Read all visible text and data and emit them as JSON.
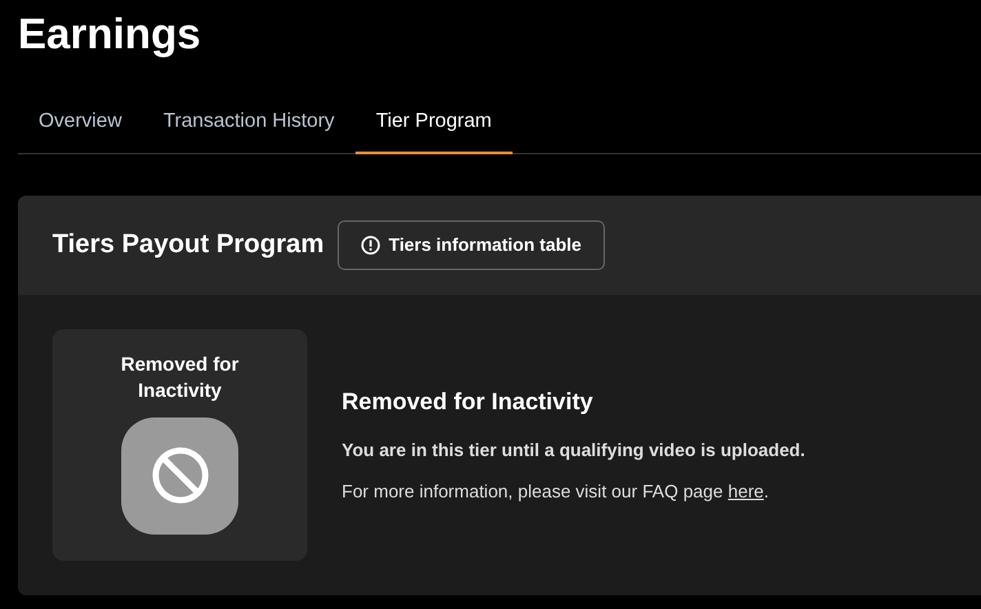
{
  "page_title": "Earnings",
  "tabs": [
    {
      "label": "Overview",
      "selected": false
    },
    {
      "label": "Transaction History",
      "selected": false
    },
    {
      "label": "Tier Program",
      "selected": true
    }
  ],
  "panel": {
    "title": "Tiers Payout Program",
    "info_button": "Tiers information table",
    "tier_card": {
      "name": "Removed for Inactivity"
    },
    "heading": "Removed for Inactivity",
    "note": "You are in this tier until a qualifying video is uploaded.",
    "info": {
      "text": "For more information, please visit our FAQ page ",
      "link": "here",
      "after": "."
    }
  }
}
